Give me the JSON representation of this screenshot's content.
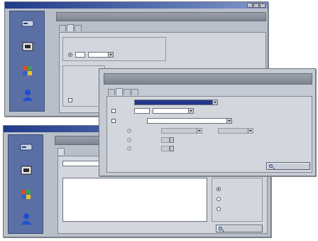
{
  "colors": {
    "titlebar_start": "#1f3a8a",
    "titlebar_end": "#7e96c8",
    "window_face": "#b9bfc8",
    "sidebar": "#5a6fa4",
    "selection": "#24368c"
  },
  "window_settings": {
    "title": "",
    "header": "",
    "tabs": [
      "",
      "",
      ""
    ],
    "group_title": "",
    "option_label": "",
    "sidebar": [
      {
        "label": "",
        "icon": "drive-icon"
      },
      {
        "label": "",
        "icon": "folder-icon"
      },
      {
        "label": "",
        "icon": "windows-icon"
      },
      {
        "label": "",
        "icon": "user-icon"
      }
    ]
  },
  "window_search": {
    "title": "",
    "header": "",
    "tab_label": "",
    "results": [
      "",
      "",
      ""
    ],
    "side_group_title": "",
    "side_options": [
      "",
      "",
      ""
    ],
    "button": "",
    "sidebar": [
      {
        "label": "",
        "icon": "drive-icon"
      },
      {
        "label": "",
        "icon": "folder-icon"
      },
      {
        "label": "",
        "icon": "windows-icon"
      },
      {
        "label": "",
        "icon": "user-icon"
      }
    ]
  },
  "search_options": {
    "header": "",
    "tabs": [
      "",
      "",
      "",
      ""
    ],
    "type_label": "",
    "type_value": "",
    "type_suffix": "",
    "size_label": "",
    "size_unit": "",
    "date_label": "",
    "date_mode": "",
    "date_rows": [
      "",
      "",
      ""
    ],
    "and_label": "",
    "within_units": [
      "",
      ""
    ],
    "button": ""
  }
}
